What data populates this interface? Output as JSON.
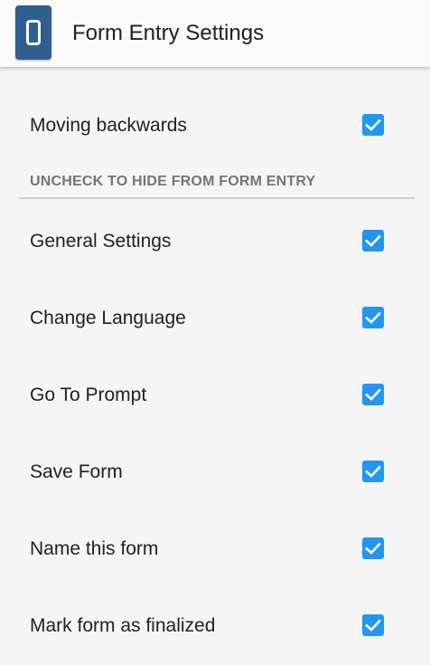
{
  "app_bar": {
    "title": "Form Entry Settings",
    "icon": "app-logo-icon"
  },
  "top_setting": {
    "label": "Moving backwards",
    "checked": true
  },
  "category": {
    "title": "UNCHECK TO HIDE FROM FORM ENTRY"
  },
  "settings": [
    {
      "label": "General Settings",
      "checked": true
    },
    {
      "label": "Change Language",
      "checked": true
    },
    {
      "label": "Go To Prompt",
      "checked": true
    },
    {
      "label": "Save Form",
      "checked": true
    },
    {
      "label": "Name this form",
      "checked": true
    },
    {
      "label": "Mark form as finalized",
      "checked": true
    }
  ],
  "colors": {
    "accent": "#2196f3",
    "app_icon": "#2f5f8f",
    "background": "#f5f5f5",
    "category_text": "#757575"
  }
}
